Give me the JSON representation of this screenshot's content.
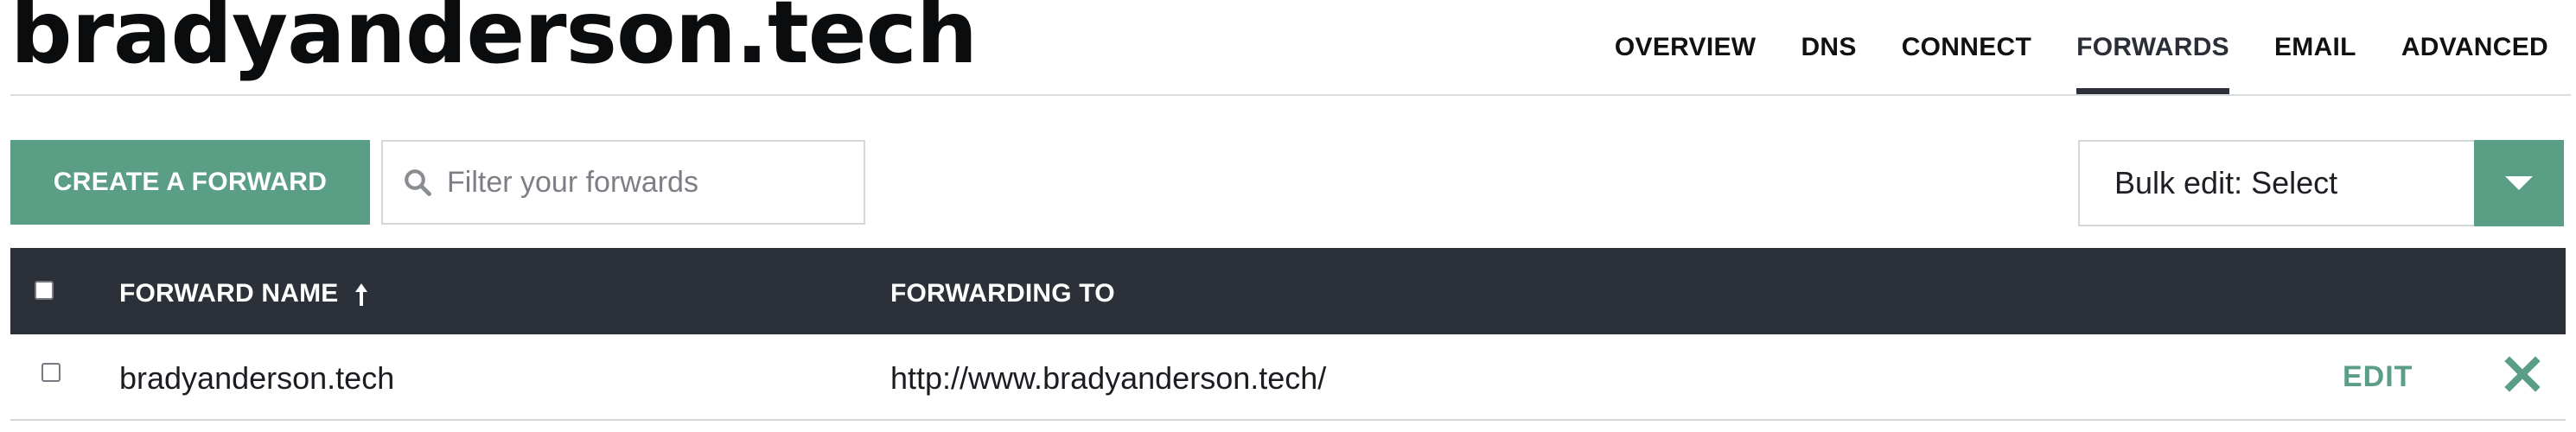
{
  "site": {
    "title": "bradyanderson.tech"
  },
  "nav": {
    "tabs": [
      {
        "label": "OVERVIEW",
        "active": false
      },
      {
        "label": "DNS",
        "active": false
      },
      {
        "label": "CONNECT",
        "active": false
      },
      {
        "label": "FORWARDS",
        "active": true
      },
      {
        "label": "EMAIL",
        "active": false
      },
      {
        "label": "ADVANCED",
        "active": false
      }
    ]
  },
  "toolbar": {
    "create_label": "CREATE A FORWARD",
    "filter_placeholder": "Filter your forwards",
    "filter_value": "",
    "bulk_edit_label": "Bulk edit: Select",
    "search_icon": "search-icon",
    "dropdown_icon": "caret-down-icon"
  },
  "table": {
    "columns": {
      "name": "FORWARD NAME",
      "target": "FORWARDING TO"
    },
    "sort": {
      "column": "name",
      "direction": "ascending",
      "icon": "arrow-up-icon"
    },
    "rows": [
      {
        "name": "bradyanderson.tech",
        "forwarding_to": "http://www.bradyanderson.tech/",
        "edit_label": "EDIT",
        "delete_icon": "close-icon"
      }
    ]
  },
  "colors": {
    "accent": "#5a9e86",
    "header_bg": "#2c3038",
    "border": "#d5d8db"
  }
}
